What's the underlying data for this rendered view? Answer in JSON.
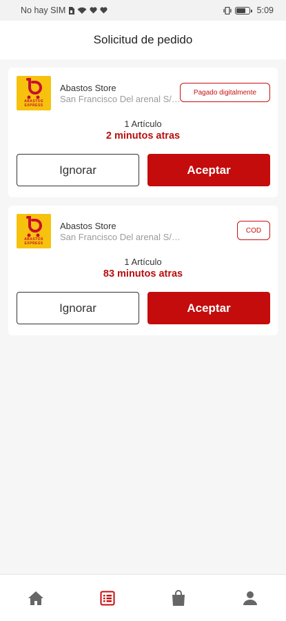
{
  "status_bar": {
    "carrier": "No hay SIM",
    "time": "5:09",
    "battery_level": 0.75
  },
  "header": {
    "title": "Solicitud de pedido"
  },
  "orders": [
    {
      "store_name": "Abastos Store",
      "address": "San Francisco Del arenal S/n, San Francisco",
      "payment_badge": "Pagado digitalmente",
      "items": "1 Artículo",
      "time_ago": "2 minutos atras",
      "ignore_label": "Ignorar",
      "accept_label": "Aceptar"
    },
    {
      "store_name": "Abastos Store",
      "address": "San Francisco Del arenal S/n, San Francisco",
      "payment_badge": "COD",
      "items": "1 Artículo",
      "time_ago": "83 minutos atras",
      "ignore_label": "Ignorar",
      "accept_label": "Aceptar"
    }
  ],
  "logo": {
    "text_line1": "ABASTOS",
    "text_line2": "EXPRESS"
  },
  "bottom_nav": {
    "items": [
      "home-icon",
      "orders-list-icon",
      "shopping-bag-icon",
      "profile-icon"
    ],
    "active_index": 1
  },
  "colors": {
    "accent": "#c40c0c",
    "logo_bg": "#f6c20e",
    "nav_inactive": "#666666"
  }
}
